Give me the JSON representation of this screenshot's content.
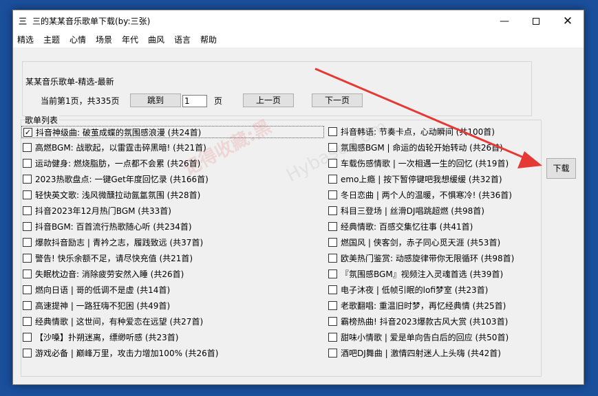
{
  "window": {
    "title": "三的某某音乐歌单下载(by:三张)",
    "controls": {
      "minimize": "—",
      "close": "✕"
    }
  },
  "menu": [
    "精选",
    "主题",
    "心情",
    "场景",
    "年代",
    "曲风",
    "语言",
    "帮助"
  ],
  "header": {
    "title": "某某音乐歌单-精选-最新",
    "page_info": "当前第1页，共335页",
    "jump_label": "跳到",
    "page_input_value": "1",
    "page_unit": "页",
    "prev_label": "上一页",
    "next_label": "下一页"
  },
  "list": {
    "title": "歌单列表",
    "left": [
      {
        "label": "抖音神级曲: 破茧成蝶的氛围感浪漫 (共24首)",
        "checked": true
      },
      {
        "label": "高燃BGM: 战歌起，以雷霆击碎黑暗! (共21首)",
        "checked": false
      },
      {
        "label": "运动健身: 燃烧脂肪，一点都不会累 (共26首)",
        "checked": false
      },
      {
        "label": "2023热歌盘点: 一键Get年度回忆录 (共166首)",
        "checked": false
      },
      {
        "label": "轻快英文歌: 浅风微醺拉动氤氲氛围 (共28首)",
        "checked": false
      },
      {
        "label": "抖音2023年12月热门BGM (共33首)",
        "checked": false
      },
      {
        "label": "抖音BGM: 百首流行热歌随心听 (共234首)",
        "checked": false
      },
      {
        "label": "爆款抖音励志 | 青衿之志，履践致远 (共37首)",
        "checked": false
      },
      {
        "label": "警告! 快乐余额不足，请尽快充值 (共21首)",
        "checked": false
      },
      {
        "label": "失眠枕边音: 消除疲劳安然入睡 (共26首)",
        "checked": false
      },
      {
        "label": "燃向日语 | 哥的低调不是虚 (共14首)",
        "checked": false
      },
      {
        "label": "高速提神 | 一路狂嗨不犯困 (共49首)",
        "checked": false
      },
      {
        "label": "经典情歌 | 这世间，有种爱恋在远望 (共27首)",
        "checked": false
      },
      {
        "label": "【沙嗓】扑朔迷离，缥缈听感 (共23首)",
        "checked": false
      },
      {
        "label": "游戏必备 | 巅峰万里，攻击力增加100% (共26首)",
        "checked": false
      }
    ],
    "right": [
      {
        "label": "抖音韩语: 节奏卡点，心动瞬间 (共100首)",
        "checked": false
      },
      {
        "label": "氛围感BGM | 命运的齿轮开始转动 (共26首)",
        "checked": false
      },
      {
        "label": "车载伤感情歌 | 一次相遇一生的回忆 (共19首)",
        "checked": false
      },
      {
        "label": "emo上瘾 | 按下暂停键吧我想缓缓 (共32首)",
        "checked": false
      },
      {
        "label": "冬日恋曲 | 两个人的温暖，不惧寒冷! (共36首)",
        "checked": false
      },
      {
        "label": "科目三登场 | 丝滑DJ唱跳超燃 (共98首)",
        "checked": false
      },
      {
        "label": "经典情歌: 百感交集忆往事 (共41首)",
        "checked": false
      },
      {
        "label": "燃国风 | 侠客剑，赤子同心觅天涯 (共53首)",
        "checked": false
      },
      {
        "label": "欧美热门鉴赏: 动感旋律带你无限循环 (共98首)",
        "checked": false
      },
      {
        "label": "『氛围感BGM』视频注入灵魂首选 (共39首)",
        "checked": false
      },
      {
        "label": "电子沐夜 | 低帧引眠的lofi梦室 (共23首)",
        "checked": false
      },
      {
        "label": "老歌翻唱: 重温旧时梦，再忆经典情 (共25首)",
        "checked": false
      },
      {
        "label": "霸榜热曲! 抖音2023爆款古风大赏 (共103首)",
        "checked": false
      },
      {
        "label": "甜味小情歌 | 爱是单向告白后的回应 (共50首)",
        "checked": false
      },
      {
        "label": "酒吧DJ舞曲 | 激情四射迷人上头嗨 (共42首)",
        "checked": false
      }
    ]
  },
  "download_label": "下载",
  "watermark": {
    "text1": "记得收藏:黑",
    "text2": "Hybase.com"
  },
  "colors": {
    "arrow": "#e53935",
    "desktop": "#1a4f9c"
  }
}
